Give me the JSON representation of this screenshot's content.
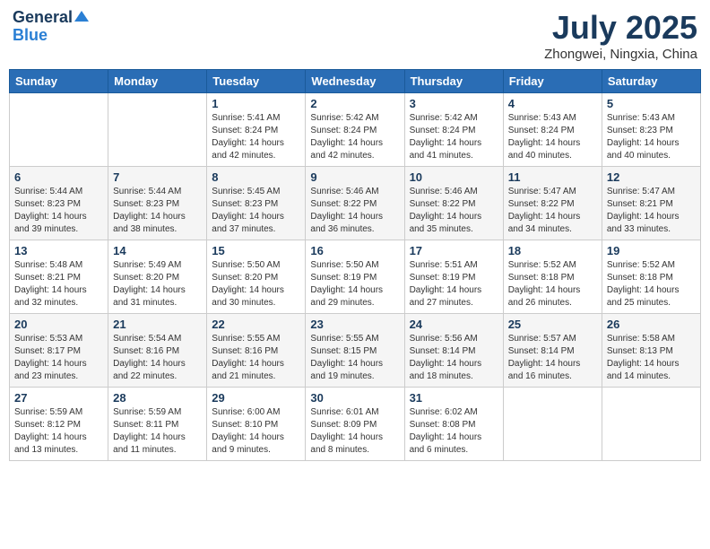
{
  "header": {
    "logo_general": "General",
    "logo_blue": "Blue",
    "title": "July 2025",
    "location": "Zhongwei, Ningxia, China"
  },
  "weekdays": [
    "Sunday",
    "Monday",
    "Tuesday",
    "Wednesday",
    "Thursday",
    "Friday",
    "Saturday"
  ],
  "weeks": [
    [
      {
        "day": "",
        "info": ""
      },
      {
        "day": "",
        "info": ""
      },
      {
        "day": "1",
        "info": "Sunrise: 5:41 AM\nSunset: 8:24 PM\nDaylight: 14 hours\nand 42 minutes."
      },
      {
        "day": "2",
        "info": "Sunrise: 5:42 AM\nSunset: 8:24 PM\nDaylight: 14 hours\nand 42 minutes."
      },
      {
        "day": "3",
        "info": "Sunrise: 5:42 AM\nSunset: 8:24 PM\nDaylight: 14 hours\nand 41 minutes."
      },
      {
        "day": "4",
        "info": "Sunrise: 5:43 AM\nSunset: 8:24 PM\nDaylight: 14 hours\nand 40 minutes."
      },
      {
        "day": "5",
        "info": "Sunrise: 5:43 AM\nSunset: 8:23 PM\nDaylight: 14 hours\nand 40 minutes."
      }
    ],
    [
      {
        "day": "6",
        "info": "Sunrise: 5:44 AM\nSunset: 8:23 PM\nDaylight: 14 hours\nand 39 minutes."
      },
      {
        "day": "7",
        "info": "Sunrise: 5:44 AM\nSunset: 8:23 PM\nDaylight: 14 hours\nand 38 minutes."
      },
      {
        "day": "8",
        "info": "Sunrise: 5:45 AM\nSunset: 8:23 PM\nDaylight: 14 hours\nand 37 minutes."
      },
      {
        "day": "9",
        "info": "Sunrise: 5:46 AM\nSunset: 8:22 PM\nDaylight: 14 hours\nand 36 minutes."
      },
      {
        "day": "10",
        "info": "Sunrise: 5:46 AM\nSunset: 8:22 PM\nDaylight: 14 hours\nand 35 minutes."
      },
      {
        "day": "11",
        "info": "Sunrise: 5:47 AM\nSunset: 8:22 PM\nDaylight: 14 hours\nand 34 minutes."
      },
      {
        "day": "12",
        "info": "Sunrise: 5:47 AM\nSunset: 8:21 PM\nDaylight: 14 hours\nand 33 minutes."
      }
    ],
    [
      {
        "day": "13",
        "info": "Sunrise: 5:48 AM\nSunset: 8:21 PM\nDaylight: 14 hours\nand 32 minutes."
      },
      {
        "day": "14",
        "info": "Sunrise: 5:49 AM\nSunset: 8:20 PM\nDaylight: 14 hours\nand 31 minutes."
      },
      {
        "day": "15",
        "info": "Sunrise: 5:50 AM\nSunset: 8:20 PM\nDaylight: 14 hours\nand 30 minutes."
      },
      {
        "day": "16",
        "info": "Sunrise: 5:50 AM\nSunset: 8:19 PM\nDaylight: 14 hours\nand 29 minutes."
      },
      {
        "day": "17",
        "info": "Sunrise: 5:51 AM\nSunset: 8:19 PM\nDaylight: 14 hours\nand 27 minutes."
      },
      {
        "day": "18",
        "info": "Sunrise: 5:52 AM\nSunset: 8:18 PM\nDaylight: 14 hours\nand 26 minutes."
      },
      {
        "day": "19",
        "info": "Sunrise: 5:52 AM\nSunset: 8:18 PM\nDaylight: 14 hours\nand 25 minutes."
      }
    ],
    [
      {
        "day": "20",
        "info": "Sunrise: 5:53 AM\nSunset: 8:17 PM\nDaylight: 14 hours\nand 23 minutes."
      },
      {
        "day": "21",
        "info": "Sunrise: 5:54 AM\nSunset: 8:16 PM\nDaylight: 14 hours\nand 22 minutes."
      },
      {
        "day": "22",
        "info": "Sunrise: 5:55 AM\nSunset: 8:16 PM\nDaylight: 14 hours\nand 21 minutes."
      },
      {
        "day": "23",
        "info": "Sunrise: 5:55 AM\nSunset: 8:15 PM\nDaylight: 14 hours\nand 19 minutes."
      },
      {
        "day": "24",
        "info": "Sunrise: 5:56 AM\nSunset: 8:14 PM\nDaylight: 14 hours\nand 18 minutes."
      },
      {
        "day": "25",
        "info": "Sunrise: 5:57 AM\nSunset: 8:14 PM\nDaylight: 14 hours\nand 16 minutes."
      },
      {
        "day": "26",
        "info": "Sunrise: 5:58 AM\nSunset: 8:13 PM\nDaylight: 14 hours\nand 14 minutes."
      }
    ],
    [
      {
        "day": "27",
        "info": "Sunrise: 5:59 AM\nSunset: 8:12 PM\nDaylight: 14 hours\nand 13 minutes."
      },
      {
        "day": "28",
        "info": "Sunrise: 5:59 AM\nSunset: 8:11 PM\nDaylight: 14 hours\nand 11 minutes."
      },
      {
        "day": "29",
        "info": "Sunrise: 6:00 AM\nSunset: 8:10 PM\nDaylight: 14 hours\nand 9 minutes."
      },
      {
        "day": "30",
        "info": "Sunrise: 6:01 AM\nSunset: 8:09 PM\nDaylight: 14 hours\nand 8 minutes."
      },
      {
        "day": "31",
        "info": "Sunrise: 6:02 AM\nSunset: 8:08 PM\nDaylight: 14 hours\nand 6 minutes."
      },
      {
        "day": "",
        "info": ""
      },
      {
        "day": "",
        "info": ""
      }
    ]
  ]
}
